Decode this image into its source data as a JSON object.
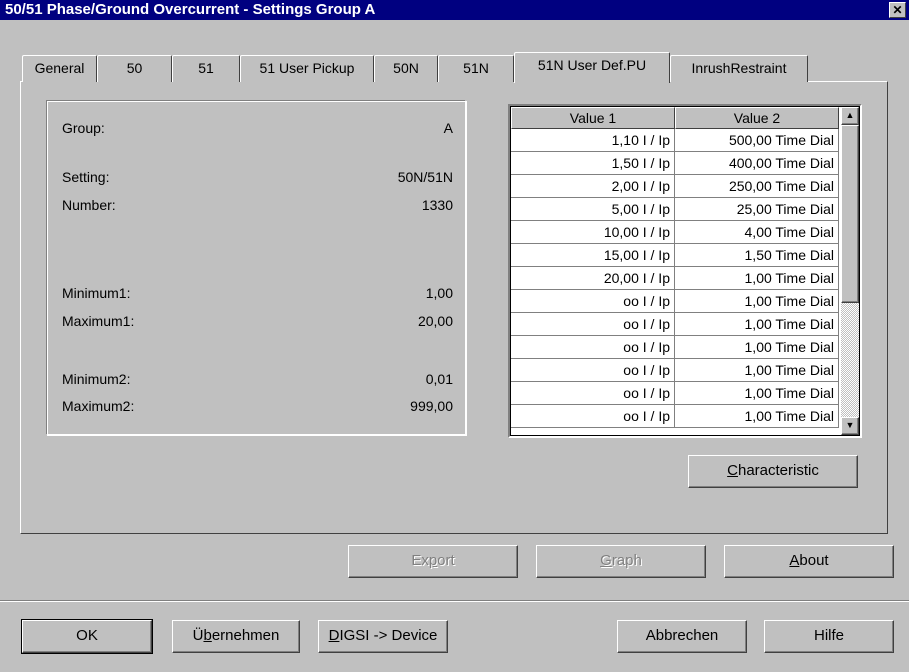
{
  "window": {
    "title": "50/51 Phase/Ground Overcurrent - Settings Group A",
    "close_glyph": "✕"
  },
  "tabs": [
    {
      "label": "General"
    },
    {
      "label": "50"
    },
    {
      "label": "51"
    },
    {
      "label": "51 User Pickup"
    },
    {
      "label": "50N"
    },
    {
      "label": "51N"
    },
    {
      "label": "51N User Def.PU",
      "active": true
    },
    {
      "label": "InrushRestraint"
    }
  ],
  "info": {
    "group_label": "Group:",
    "group_value": "A",
    "setting_label": "Setting:",
    "setting_value": "50N/51N",
    "number_label": "Number:",
    "number_value": "1330",
    "min1_label": "Minimum1:",
    "min1_value": "1,00",
    "max1_label": "Maximum1:",
    "max1_value": "20,00",
    "min2_label": "Minimum2:",
    "min2_value": "0,01",
    "max2_label": "Maximum2:",
    "max2_value": "999,00"
  },
  "table": {
    "columns": [
      "Value 1",
      "Value 2"
    ],
    "rows": [
      [
        "1,10 I / Ip",
        "500,00 Time Dial"
      ],
      [
        "1,50 I / Ip",
        "400,00 Time Dial"
      ],
      [
        "2,00 I / Ip",
        "250,00 Time Dial"
      ],
      [
        "5,00 I / Ip",
        "25,00 Time Dial"
      ],
      [
        "10,00 I / Ip",
        "4,00 Time Dial"
      ],
      [
        "15,00 I / Ip",
        "1,50 Time Dial"
      ],
      [
        "20,00 I / Ip",
        "1,00 Time Dial"
      ],
      [
        "oo I / Ip",
        "1,00 Time Dial"
      ],
      [
        "oo I / Ip",
        "1,00 Time Dial"
      ],
      [
        "oo I / Ip",
        "1,00 Time Dial"
      ],
      [
        "oo I / Ip",
        "1,00 Time Dial"
      ],
      [
        "oo I / Ip",
        "1,00 Time Dial"
      ],
      [
        "oo I / Ip",
        "1,00 Time Dial"
      ]
    ],
    "scroll_up_glyph": "▲",
    "scroll_down_glyph": "▼"
  },
  "buttons": {
    "characteristic": {
      "hot": "C",
      "rest": "haracteristic"
    },
    "export": {
      "pre": "Ex",
      "hot": "p",
      "rest": "ort"
    },
    "graph": {
      "hot": "G",
      "rest": "raph"
    },
    "about": {
      "hot": "A",
      "rest": "bout"
    },
    "ok": "OK",
    "apply": {
      "pre": "Ü",
      "hot": "b",
      "rest": "ernehmen"
    },
    "digsi": {
      "hot": "D",
      "rest": "IGSI -> Device"
    },
    "cancel": "Abbrechen",
    "help": "Hilfe"
  }
}
